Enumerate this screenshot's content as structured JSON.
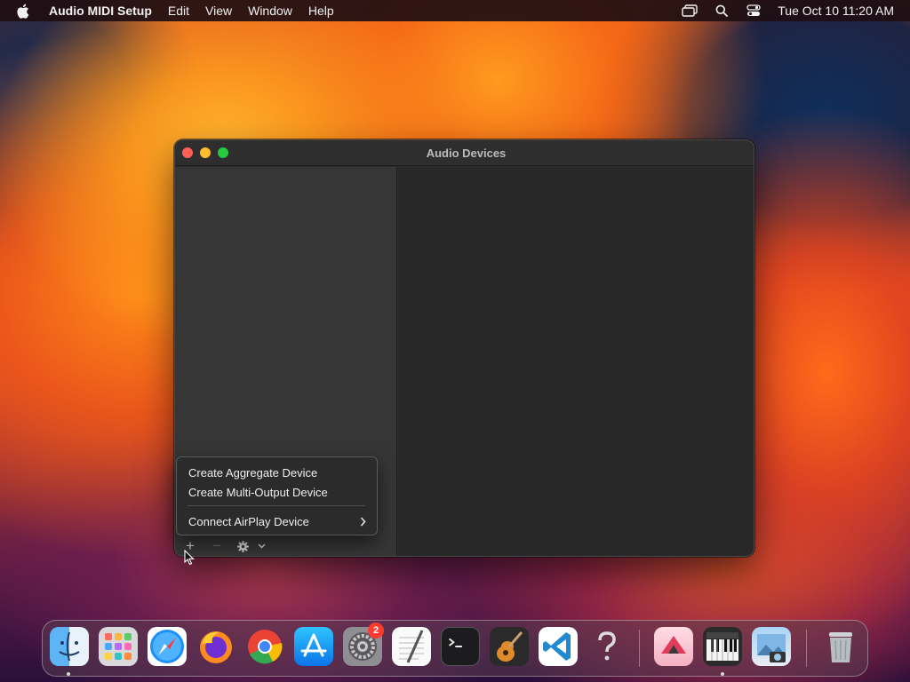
{
  "menubar": {
    "app_name": "Audio MIDI Setup",
    "items": [
      "Edit",
      "View",
      "Window",
      "Help"
    ],
    "clock": "Tue Oct 10  11:20 AM",
    "status_icons": [
      "screen-mirroring-icon",
      "spotlight-search-icon",
      "control-center-icon"
    ]
  },
  "window": {
    "title": "Audio Devices"
  },
  "popup_menu": {
    "items": [
      {
        "label": "Create Aggregate Device"
      },
      {
        "label": "Create Multi-Output Device"
      },
      {
        "label": "Connect AirPlay Device",
        "submenu": true
      }
    ]
  },
  "toolbar": {
    "add_symbol": "+",
    "remove_symbol": "−"
  },
  "dock": {
    "apps": [
      "Finder",
      "Launchpad",
      "Safari",
      "Firefox",
      "Chrome",
      "App Store",
      "System Settings",
      "TextEdit",
      "Terminal",
      "GarageBand",
      "Visual Studio Code",
      "Help",
      "Artstudio",
      "Audio MIDI Setup",
      "Preview",
      "Trash"
    ],
    "settings_badge": "2"
  },
  "colors": {
    "close": "#ff5f57",
    "minimize": "#febc2e",
    "maximize": "#28c840",
    "badge": "#ff3b30"
  }
}
